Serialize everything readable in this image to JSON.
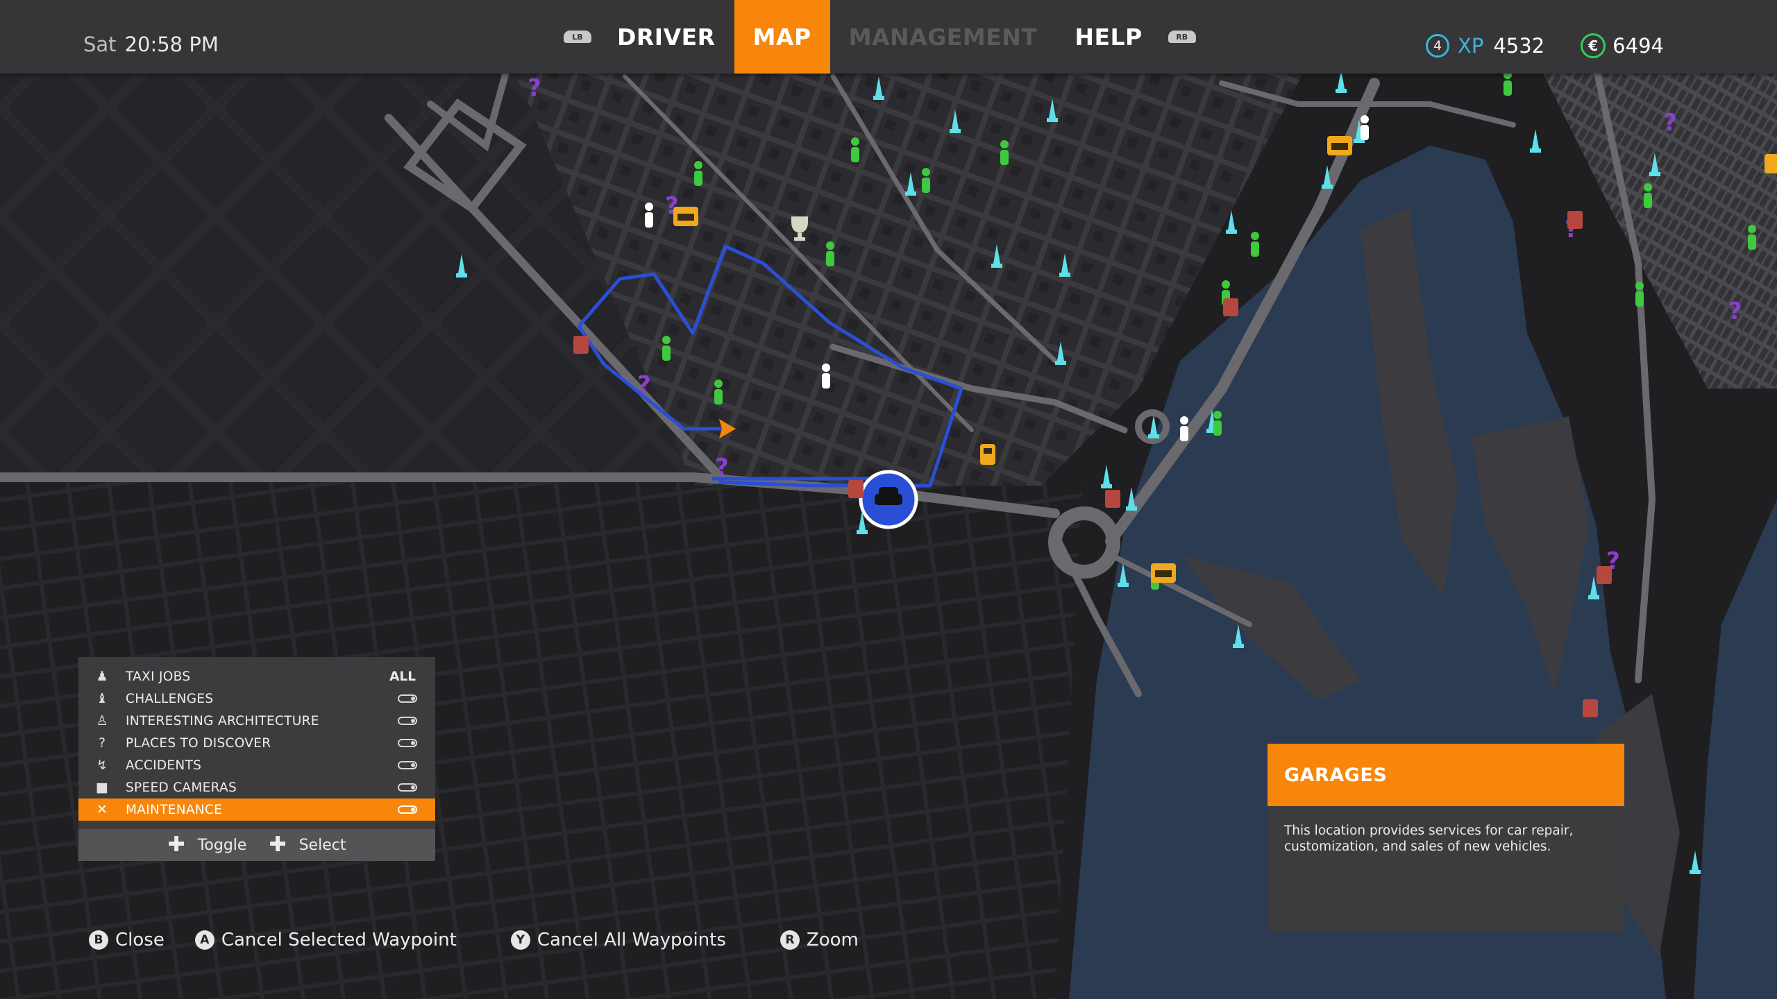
{
  "header": {
    "day": "Sat",
    "time": "20:58 PM",
    "lb_label": "LB",
    "rb_label": "RB",
    "tabs": [
      {
        "label": "DRIVER",
        "state": "normal"
      },
      {
        "label": "MAP",
        "state": "active"
      },
      {
        "label": "MANAGEMENT",
        "state": "disabled"
      },
      {
        "label": "HELP",
        "state": "normal"
      }
    ],
    "level": "4",
    "xp_label": "XP",
    "xp_value": "4532",
    "currency_symbol": "€",
    "money": "6494"
  },
  "legend": {
    "rows": [
      {
        "label": "TAXI JOBS",
        "icon": "person-icon",
        "state": "ALL"
      },
      {
        "label": "CHALLENGES",
        "icon": "trophy-icon"
      },
      {
        "label": "INTERESTING ARCHITECTURE",
        "icon": "monument-icon"
      },
      {
        "label": "PLACES TO DISCOVER",
        "icon": "question-icon"
      },
      {
        "label": "ACCIDENTS",
        "icon": "accident-icon"
      },
      {
        "label": "SPEED CAMERAS",
        "icon": "camera-icon"
      },
      {
        "label": "MAINTENANCE",
        "icon": "wrench-icon",
        "selected": true
      }
    ],
    "toggle_label": "Toggle",
    "select_label": "Select"
  },
  "info_panel": {
    "title": "GARAGES",
    "body": "This location provides services for car repair, customization, and sales of new vehicles."
  },
  "hints": [
    {
      "button": "B",
      "label": "Close"
    },
    {
      "button": "A",
      "label": "Cancel Selected Waypoint"
    },
    {
      "button": "Y",
      "label": "Cancel All Waypoints"
    },
    {
      "button": "R",
      "label": "Zoom"
    }
  ],
  "colors": {
    "accent": "#f7860a",
    "route": "#2a4fd6",
    "monument": "#5ee0e8",
    "passenger": "#3ec93e",
    "discover": "#8a3fd1",
    "camera": "#b6473e",
    "xp": "#3bb6d9",
    "money": "#2ecf59",
    "water": "#2a3b52"
  }
}
